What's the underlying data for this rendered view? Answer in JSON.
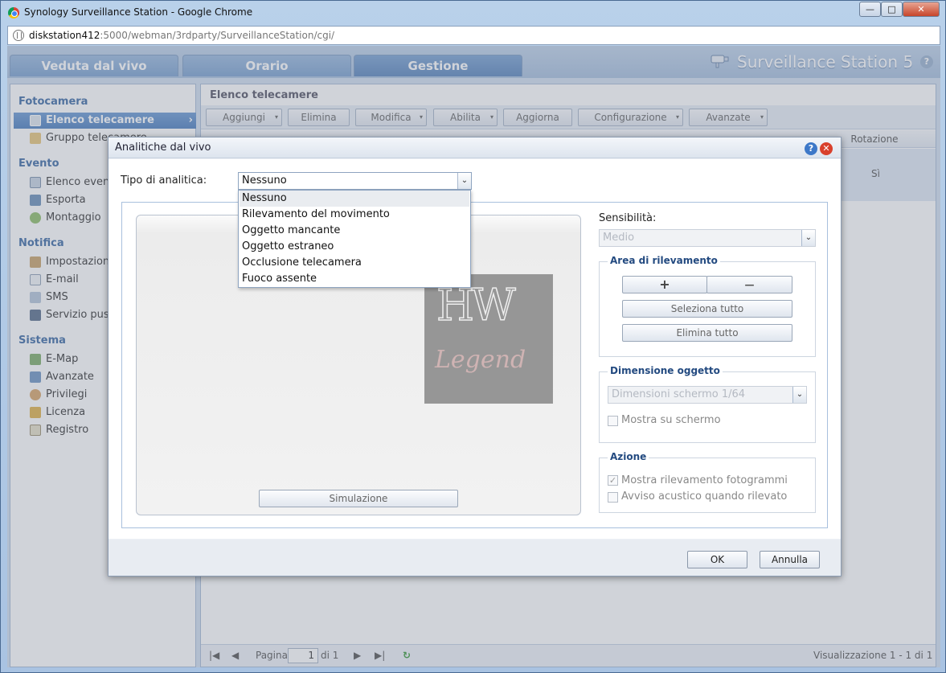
{
  "window": {
    "title": "Synology Surveillance Station - Google Chrome",
    "controls": {
      "minimize": "—",
      "maximize": "□",
      "close": "✕"
    }
  },
  "address": {
    "host": "diskstation412",
    "rest": ":5000/webman/3rdparty/SurveillanceStation/cgi/"
  },
  "tabs": [
    "Veduta dal vivo",
    "Orario",
    "Gestione"
  ],
  "brand": {
    "name": "Surveillance Station 5",
    "help": "?"
  },
  "sidebar": {
    "sections": [
      {
        "label": "Fotocamera",
        "items": [
          "Elenco telecamere",
          "Gruppo telecamere"
        ]
      },
      {
        "label": "Evento",
        "items": [
          "Elenco eventi",
          "Esporta",
          "Montaggio"
        ]
      },
      {
        "label": "Notifica",
        "items": [
          "Impostazioni",
          "E-mail",
          "SMS",
          "Servizio push"
        ]
      },
      {
        "label": "Sistema",
        "items": [
          "E-Map",
          "Avanzate",
          "Privilegi",
          "Licenza",
          "Registro"
        ]
      }
    ],
    "arrow": "›"
  },
  "main": {
    "title": "Elenco telecamere",
    "toolbar": [
      "Aggiungi",
      "Elimina",
      "Modifica",
      "Abilita",
      "Aggiorna",
      "Configurazione",
      "Avanzate"
    ],
    "dropdown_arrow": "▾",
    "columns": [
      "Rotazione"
    ],
    "row": {
      "rotation": "Sì"
    },
    "pager": {
      "first": "|◀",
      "prev": "◀",
      "page_label": "Pagina",
      "page": "1",
      "of": "di 1",
      "next": "▶",
      "last": "▶|",
      "refresh": "↻",
      "summary": "Visualizzazione 1 - 1 di 1"
    }
  },
  "dialog": {
    "title": "Analitiche dal vivo",
    "help": "?",
    "close": "✕",
    "analytics_label": "Tipo di analitica:",
    "analytics_value": "Nessuno",
    "analytics_options": [
      "Nessuno",
      "Rilevamento del movimento",
      "Oggetto mancante",
      "Oggetto estraneo",
      "Occlusione telecamera",
      "Fuoco assente"
    ],
    "combo_arrow": "⌄",
    "simulate": "Simulazione",
    "watermark": {
      "top": "HW",
      "bottom": "Legend"
    },
    "sensitivity_label": "Sensibilità:",
    "sensitivity_value": "Medio",
    "area": {
      "title": "Area di rilevamento",
      "add": "+",
      "remove": "—",
      "select_all": "Seleziona tutto",
      "clear_all": "Elimina tutto"
    },
    "object_size": {
      "title": "Dimensione oggetto",
      "value": "Dimensioni schermo 1/64",
      "show": "Mostra su schermo"
    },
    "action": {
      "title": "Azione",
      "show_frames": "Mostra rilevamento fotogrammi",
      "show_frames_check": "✓",
      "beep": "Avviso acustico quando rilevato"
    },
    "ok": "OK",
    "cancel": "Annulla"
  }
}
